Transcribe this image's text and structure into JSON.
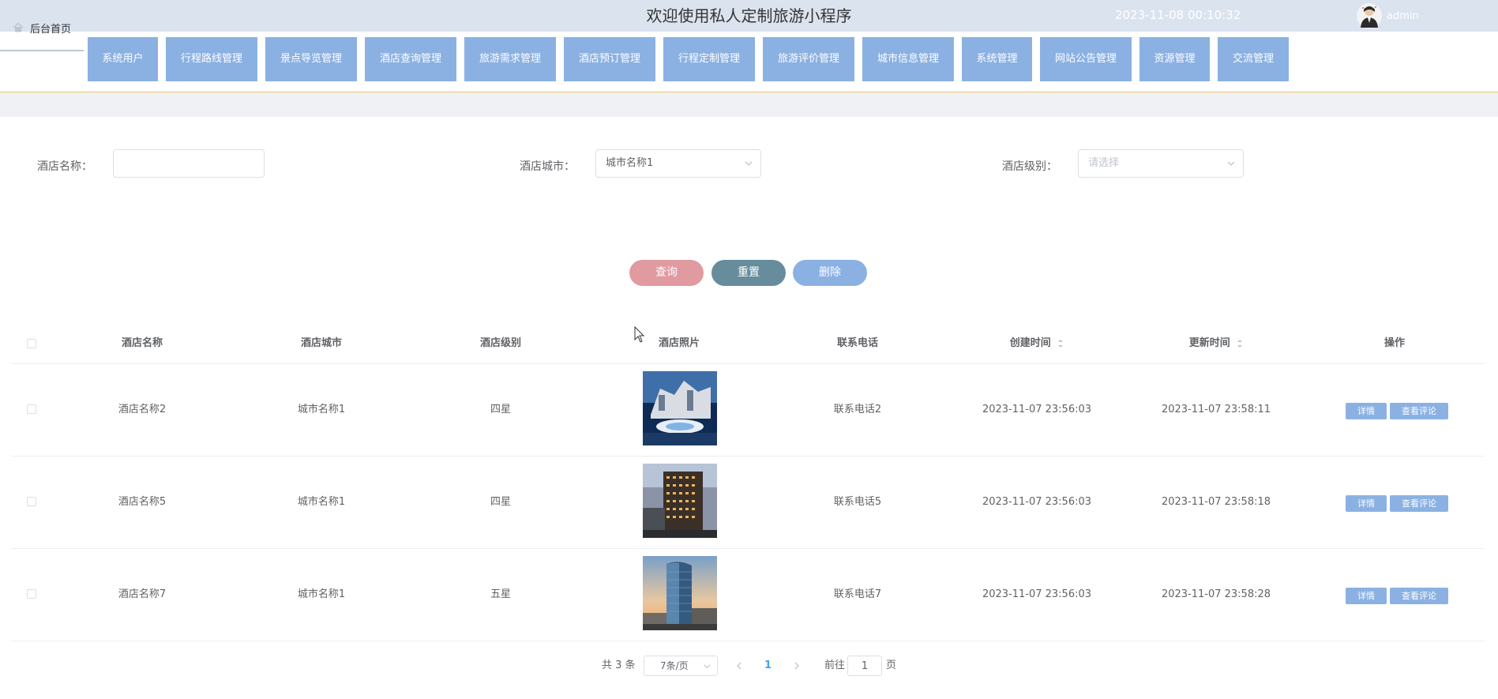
{
  "header": {
    "title": "欢迎使用私人定制旅游小程序",
    "datetime": "2023-11-08 00:10:32",
    "username": "admin"
  },
  "nav": {
    "home": "后台首页",
    "items": [
      "系统用户",
      "行程路线管理",
      "景点导览管理",
      "酒店查询管理",
      "旅游需求管理",
      "酒店预订管理",
      "行程定制管理",
      "旅游评价管理",
      "城市信息管理",
      "系统管理",
      "网站公告管理",
      "资源管理",
      "交流管理"
    ]
  },
  "filters": {
    "name_label": "酒店名称：",
    "name_value": "",
    "city_label": "酒店城市：",
    "city_value": "城市名称1",
    "level_label": "酒店级别：",
    "level_placeholder": "请选择"
  },
  "buttons": {
    "query": "查询",
    "reset": "重置",
    "delete": "删除"
  },
  "table": {
    "columns": [
      "酒店名称",
      "酒店城市",
      "酒店级别",
      "酒店照片",
      "联系电话",
      "创建时间",
      "更新时间",
      "操作"
    ],
    "rows": [
      {
        "name": "酒店名称2",
        "city": "城市名称1",
        "level": "四星",
        "phone": "联系电话2",
        "created": "2023-11-07 23:56:03",
        "updated": "2023-11-07 23:58:11"
      },
      {
        "name": "酒店名称5",
        "city": "城市名称1",
        "level": "四星",
        "phone": "联系电话5",
        "created": "2023-11-07 23:56:03",
        "updated": "2023-11-07 23:58:18"
      },
      {
        "name": "酒店名称7",
        "city": "城市名称1",
        "level": "五星",
        "phone": "联系电话7",
        "created": "2023-11-07 23:56:03",
        "updated": "2023-11-07 23:58:28"
      }
    ],
    "actions": {
      "detail": "详情",
      "comments": "查看评论"
    }
  },
  "pagination": {
    "total": "共 3 条",
    "page_size": "7条/页",
    "current_page": "1",
    "goto_prefix": "前往",
    "goto_value": "1",
    "goto_suffix": "页"
  },
  "colors": {
    "nav_button": "#8bb1e3",
    "query_button": "#e09aa0",
    "reset_button": "#678d9d",
    "delete_button": "#8bb1e3",
    "accent_link": "#409eff"
  }
}
